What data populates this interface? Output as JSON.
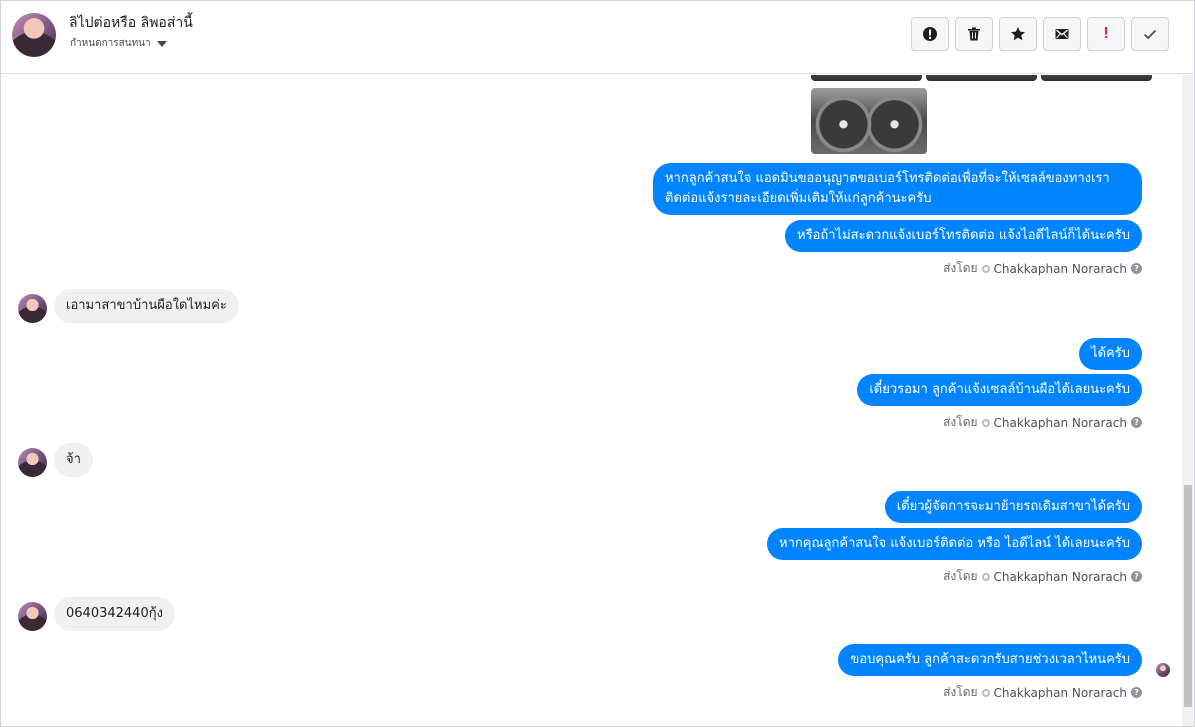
{
  "header": {
    "contact_name": "ลิไปต่อหรือ ลิพอส่านี้",
    "conversation_label": "กำหนดการสนทนา",
    "actions": [
      {
        "name": "spam-button",
        "icon": "alert-circle-icon"
      },
      {
        "name": "delete-button",
        "icon": "trash-icon"
      },
      {
        "name": "star-button",
        "icon": "star-icon"
      },
      {
        "name": "mark-unread-button",
        "icon": "mail-icon"
      },
      {
        "name": "important-button",
        "icon": "exclamation-icon",
        "label": "!"
      },
      {
        "name": "done-button",
        "icon": "check-icon"
      }
    ]
  },
  "messages": {
    "out_1a": "หากลูกค้าสนใจ แอดมินขออนุญาตขอเบอร์โทรติดต่อเพื่อที่จะให้เซลล์ของทางเราติดต่อแจ้งรายละเอียดเพิ่มเติมให้แก่ลูกค้านะครับ",
    "out_1b": "หรือถ้าไม่สะดวกแจ้งเบอร์โทรติดต่อ แจ้งไอดีไลน์ก็ได้นะครับ",
    "in_1": "เอามาสาขาบ้านผือใดไหมค่ะ",
    "out_2a": "ได้ครับ",
    "out_2b": "เดี๋ยวรอมา ลูกค้าแจ้งเซลล์บ้านผือได้เลยนะครับ",
    "in_2": "จ้า",
    "out_3a": "เดี๋ยวผู้จัดการจะมาย้ายรถเดิมสาขาได้ครับ",
    "out_3b": "หากคุณลูกค้าสนใจ แจ้งเบอร์ติดต่อ หรือ ไอดีไลน์ ได้เลยนะครับ",
    "in_3": "0640342440กุ้ง",
    "out_4": "ขอบคุณครับ ลูกค้าสะดวกรับสายช่วงเวลาไหนครับ"
  },
  "sent_by": {
    "prefix": "ส่งโดย",
    "agent": "Chakkaphan Norarach",
    "help": "?"
  },
  "colors": {
    "outgoing_bubble": "#0084ff",
    "incoming_bubble": "#f1f0f0",
    "important_accent": "#e0245e"
  }
}
